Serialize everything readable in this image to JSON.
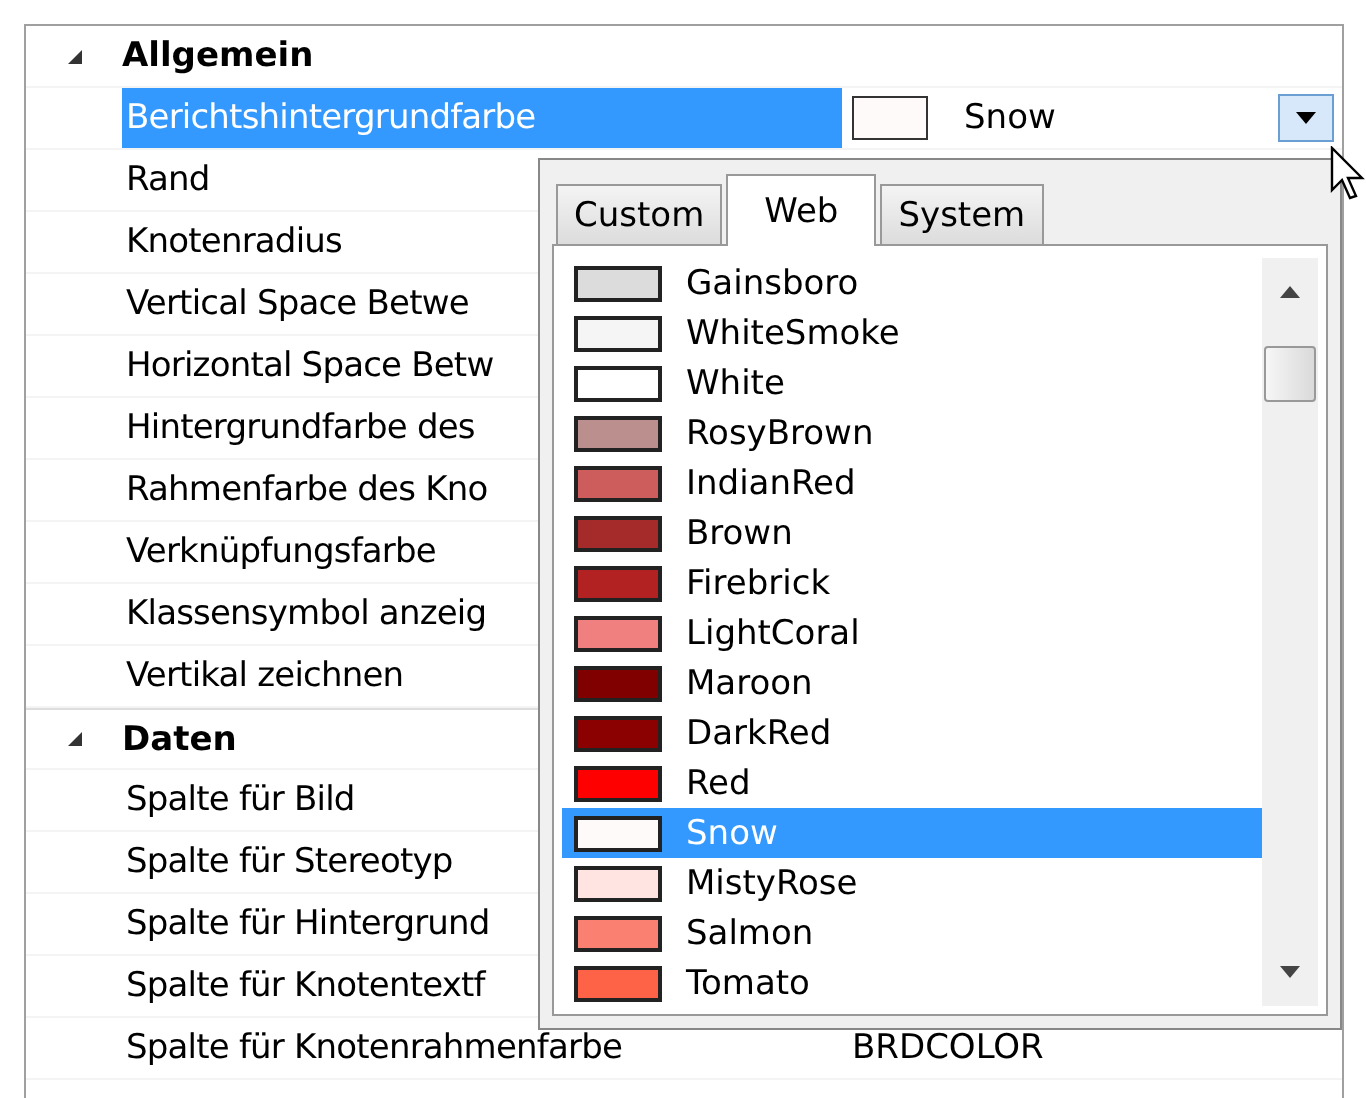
{
  "sections": [
    {
      "title": "Allgemein",
      "expanded": true,
      "properties": [
        {
          "name": "Berichtshintergrundfarbe",
          "selected": true,
          "value": "Snow",
          "color": "#fffafa",
          "dropdown": true
        },
        {
          "name": "Rand",
          "selected": false
        },
        {
          "name": "Knotenradius",
          "selected": false
        },
        {
          "name": "Vertical Space Betwe",
          "selected": false
        },
        {
          "name": "Horizontal Space Betw",
          "selected": false
        },
        {
          "name": "Hintergrundfarbe des",
          "selected": false
        },
        {
          "name": "Rahmenfarbe des Kno",
          "selected": false
        },
        {
          "name": "Verknüpfungsfarbe",
          "selected": false
        },
        {
          "name": "Klassensymbol anzeig",
          "selected": false
        },
        {
          "name": "Vertikal zeichnen",
          "selected": false
        }
      ]
    },
    {
      "title": "Daten",
      "expanded": true,
      "properties": [
        {
          "name": "Spalte für Bild",
          "selected": false
        },
        {
          "name": "Spalte für Stereotyp",
          "selected": false
        },
        {
          "name": "Spalte für Hintergrund",
          "selected": false
        },
        {
          "name": "Spalte für Knotentextf",
          "selected": false
        },
        {
          "name": "Spalte für Knotenrahmenfarbe",
          "selected": false,
          "value": "BRDCOLOR"
        }
      ]
    }
  ],
  "color_picker": {
    "tabs": [
      {
        "label": "Custom",
        "selected": false
      },
      {
        "label": "Web",
        "selected": true
      },
      {
        "label": "System",
        "selected": false
      }
    ],
    "colors": [
      {
        "name": "Gainsboro",
        "color": "#dcdcdc",
        "selected": false
      },
      {
        "name": "WhiteSmoke",
        "color": "#f5f5f5",
        "selected": false
      },
      {
        "name": "White",
        "color": "#ffffff",
        "selected": false
      },
      {
        "name": "RosyBrown",
        "color": "#bc8f8f",
        "selected": false
      },
      {
        "name": "IndianRed",
        "color": "#cd5c5c",
        "selected": false
      },
      {
        "name": "Brown",
        "color": "#a52a2a",
        "selected": false
      },
      {
        "name": "Firebrick",
        "color": "#b22222",
        "selected": false
      },
      {
        "name": "LightCoral",
        "color": "#f08080",
        "selected": false
      },
      {
        "name": "Maroon",
        "color": "#800000",
        "selected": false
      },
      {
        "name": "DarkRed",
        "color": "#8b0000",
        "selected": false
      },
      {
        "name": "Red",
        "color": "#ff0000",
        "selected": false
      },
      {
        "name": "Snow",
        "color": "#fffafa",
        "selected": true
      },
      {
        "name": "MistyRose",
        "color": "#ffe4e1",
        "selected": false
      },
      {
        "name": "Salmon",
        "color": "#fa8072",
        "selected": false
      },
      {
        "name": "Tomato",
        "color": "#ff6347",
        "selected": false
      }
    ]
  }
}
